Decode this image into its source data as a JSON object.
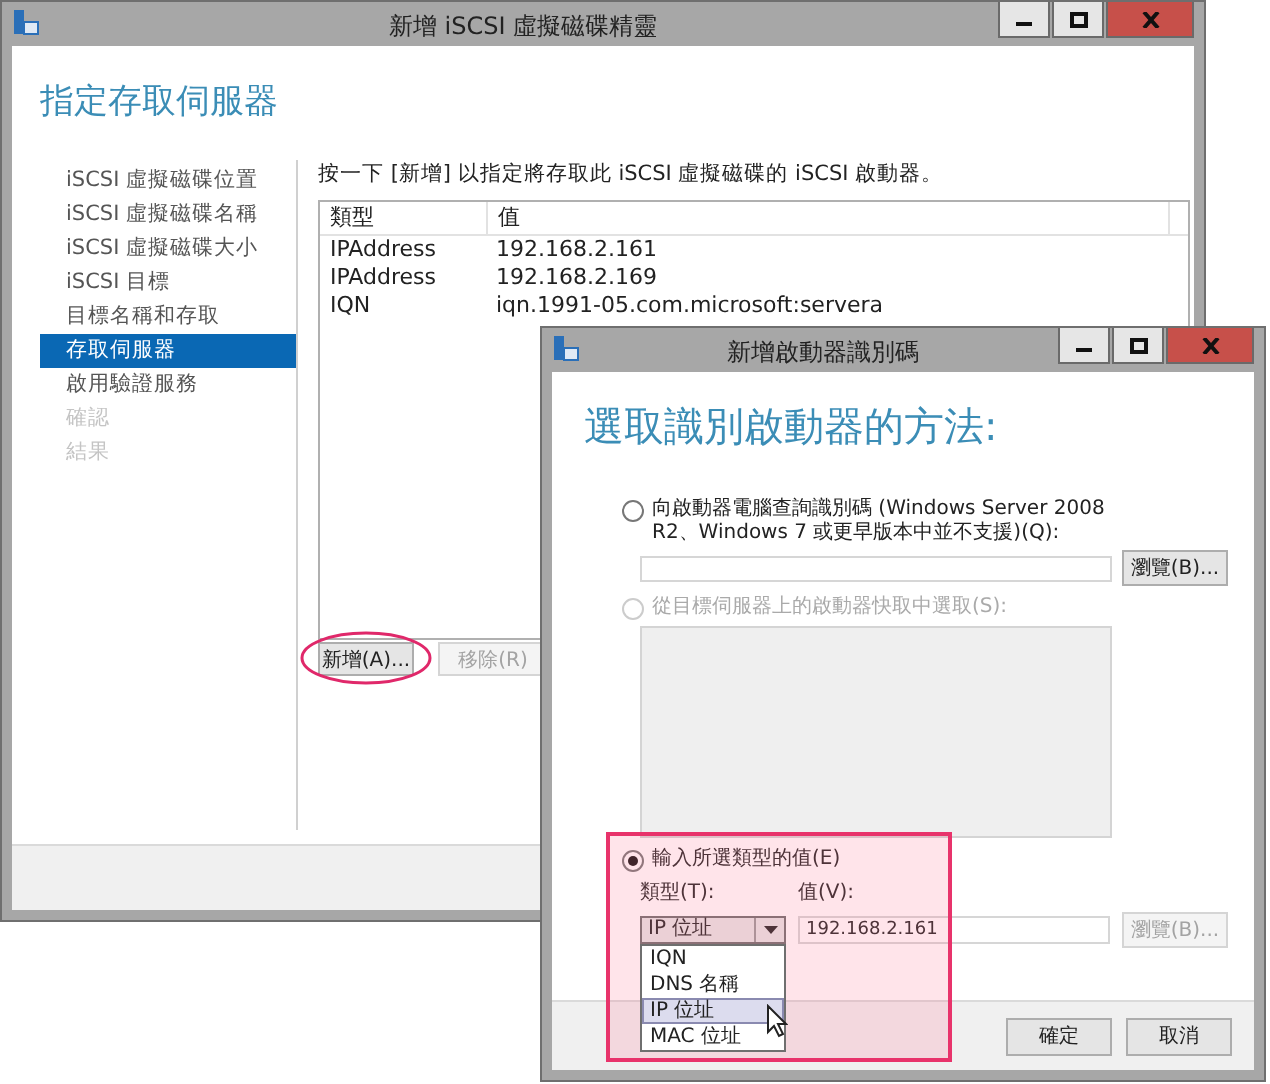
{
  "main_window": {
    "title": "新增 iSCSI 虛擬磁碟精靈",
    "heading": "指定存取伺服器",
    "steps": [
      {
        "label": "iSCSI 虛擬磁碟位置",
        "selected": false,
        "disabled": false
      },
      {
        "label": "iSCSI 虛擬磁碟名稱",
        "selected": false,
        "disabled": false
      },
      {
        "label": "iSCSI 虛擬磁碟大小",
        "selected": false,
        "disabled": false
      },
      {
        "label": "iSCSI 目標",
        "selected": false,
        "disabled": false
      },
      {
        "label": "目標名稱和存取",
        "selected": false,
        "disabled": false
      },
      {
        "label": "存取伺服器",
        "selected": true,
        "disabled": false
      },
      {
        "label": "啟用驗證服務",
        "selected": false,
        "disabled": false
      },
      {
        "label": "確認",
        "selected": false,
        "disabled": true
      },
      {
        "label": "結果",
        "selected": false,
        "disabled": true
      }
    ],
    "instruction": "按一下 [新增] 以指定將存取此 iSCSI 虛擬磁碟的 iSCSI 啟動器。",
    "table": {
      "columns": [
        "類型",
        "值"
      ],
      "rows": [
        [
          "IPAddress",
          "192.168.2.161"
        ],
        [
          "IPAddress",
          "192.168.2.169"
        ],
        [
          "IQN",
          "iqn.1991-05.com.microsoft:servera"
        ]
      ]
    },
    "buttons": [
      {
        "label": "新增(A)...",
        "disabled": false,
        "circled": true
      },
      {
        "label": "移除(R)",
        "disabled": true,
        "circled": false
      }
    ]
  },
  "dialog": {
    "title": "新增啟動器識別碼",
    "heading": "選取識別啟動器的方法:",
    "options": [
      {
        "kind": "query",
        "label": "向啟動器電腦查詢識別碼 (Windows Server 2008 R2、Windows 7 或更早版本中並不支援)(Q):",
        "selected": false,
        "disabled": false,
        "browse": {
          "label": "瀏覽(B)...",
          "disabled": false
        }
      },
      {
        "kind": "cache",
        "label": "從目標伺服器上的啟動器快取中選取(S):",
        "selected": false,
        "disabled": true
      },
      {
        "kind": "manual",
        "label": "輸入所選類型的值(E)",
        "selected": true,
        "disabled": false,
        "highlighted": true,
        "type_label": "類型(T):",
        "type_value": "IP 位址",
        "type_options": [
          {
            "label": "IQN",
            "selected": false
          },
          {
            "label": "DNS 名稱",
            "selected": false
          },
          {
            "label": "IP 位址",
            "selected": true
          },
          {
            "label": "MAC 位址",
            "selected": false
          }
        ],
        "value_label": "值(V):",
        "value": "192.168.2.161",
        "browse": {
          "label": "瀏覽(B)...",
          "disabled": true
        }
      }
    ],
    "buttons": [
      "確定",
      "取消"
    ]
  }
}
